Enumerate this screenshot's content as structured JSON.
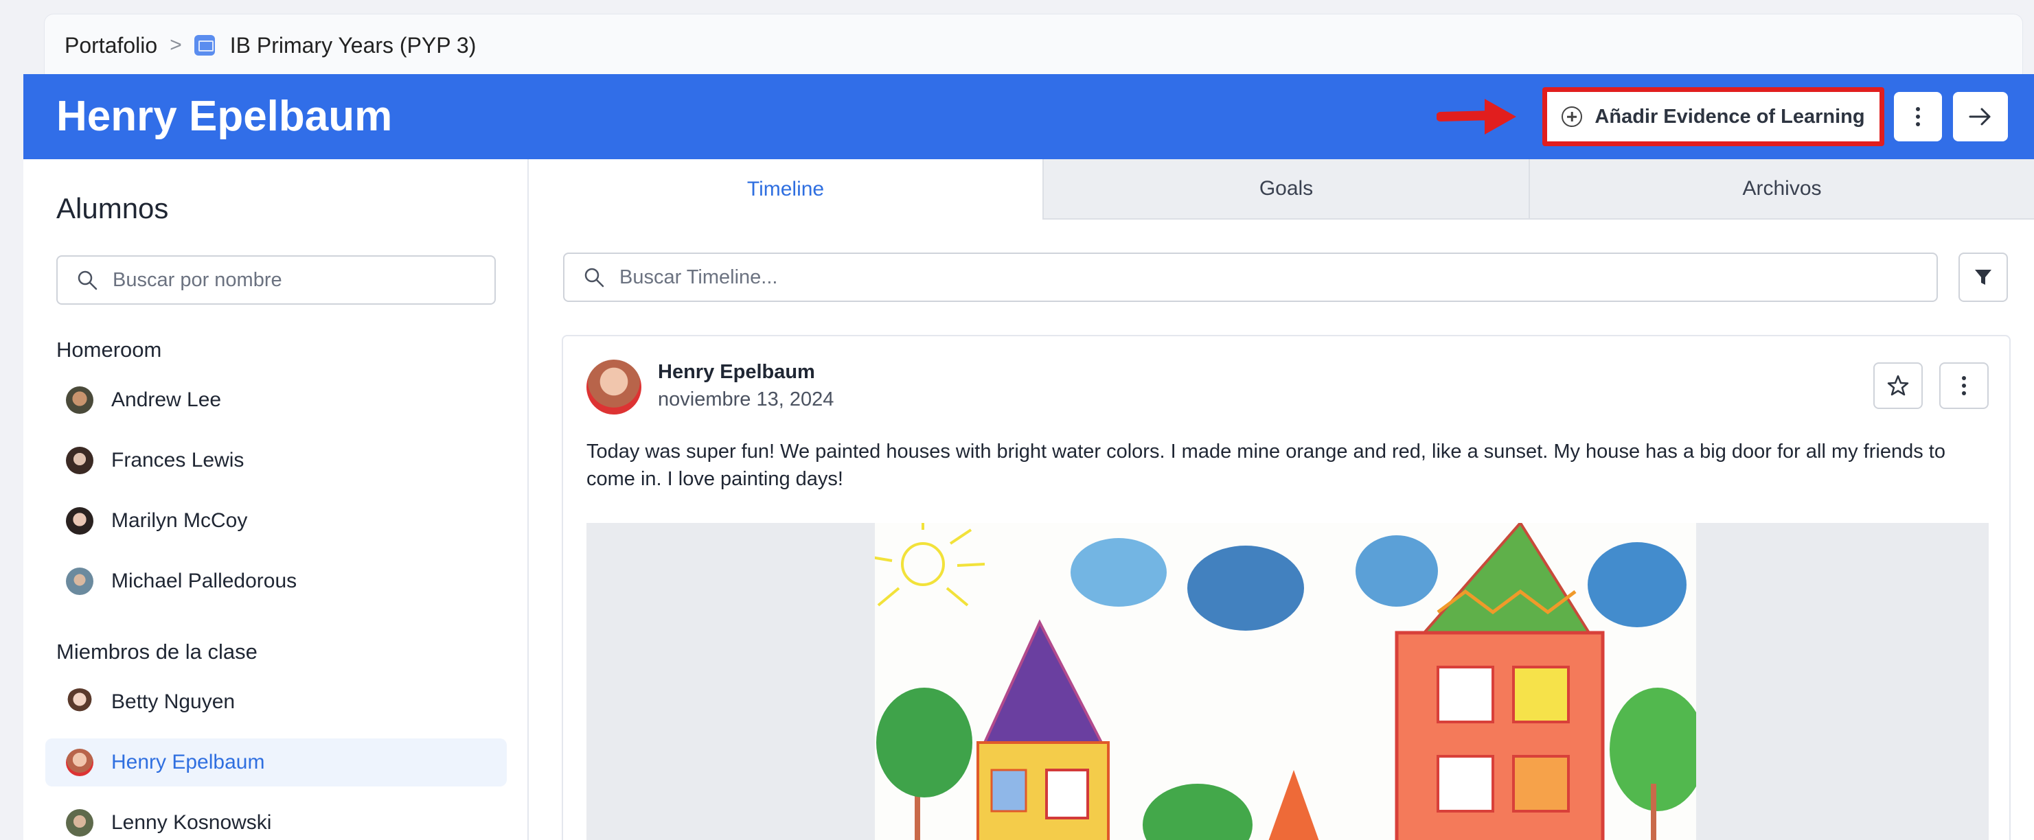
{
  "breadcrumb": {
    "root": "Portafolio",
    "separator": ">",
    "course": "IB Primary Years (PYP 3)"
  },
  "header": {
    "student_name": "Henry Epelbaum",
    "add_button_label": "Añadir Evidence of Learning",
    "accent_color": "#316ee8",
    "highlight_color": "#e11e1e"
  },
  "sidebar": {
    "title": "Alumnos",
    "search_placeholder": "Buscar por nombre",
    "groups": [
      {
        "label": "Homeroom",
        "students": [
          "Andrew Lee",
          "Frances Lewis",
          "Marilyn McCoy",
          "Michael Palledorous"
        ]
      },
      {
        "label": "Miembros de la clase",
        "students": [
          "Betty Nguyen",
          "Henry Epelbaum",
          "Lenny Kosnowski"
        ]
      }
    ],
    "selected_student": "Henry Epelbaum"
  },
  "tabs": [
    {
      "label": "Timeline",
      "active": true
    },
    {
      "label": "Goals",
      "active": false
    },
    {
      "label": "Archivos",
      "active": false
    }
  ],
  "timeline": {
    "search_placeholder": "Buscar Timeline...",
    "post": {
      "author": "Henry Epelbaum",
      "date": "noviembre 13, 2024",
      "text": "Today was super fun! We painted houses with bright water colors. I made mine orange and red, like a sunset. My house has a big door for all my friends to come in. I love painting days!"
    }
  },
  "icons": {
    "breadcrumb_course": "course-icon",
    "add": "plus-circle-icon",
    "more": "kebab-icon",
    "next": "arrow-right-icon",
    "search": "search-icon",
    "filter": "filter-icon",
    "favorite": "star-icon"
  }
}
